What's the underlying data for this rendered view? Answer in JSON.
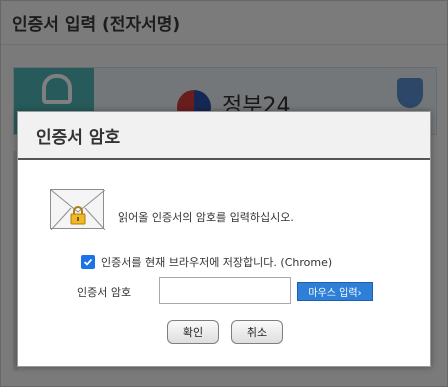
{
  "background": {
    "window_title": "인증서 입력 (전자서명)",
    "banner_text": "정부24"
  },
  "dialog": {
    "title": "인증서 암호",
    "message": "읽어올 인증서의 암호를 입력하십시오.",
    "save_checkbox": {
      "label": "인증서를 현재 브라우저에 저장합니다. (Chrome)",
      "checked": true
    },
    "password_label": "인증서 암호",
    "password_value": "",
    "mouse_input_button": "마우스 입력›",
    "ok_button": "확인",
    "cancel_button": "취소"
  },
  "colors": {
    "accent": "#2d7fd8",
    "checkbox": "#1a73e8"
  },
  "icons": [
    "envelope-icon",
    "lock-icon",
    "checkmark-icon",
    "gov-emblem-icon",
    "shield-icon",
    "unlock-icon"
  ]
}
